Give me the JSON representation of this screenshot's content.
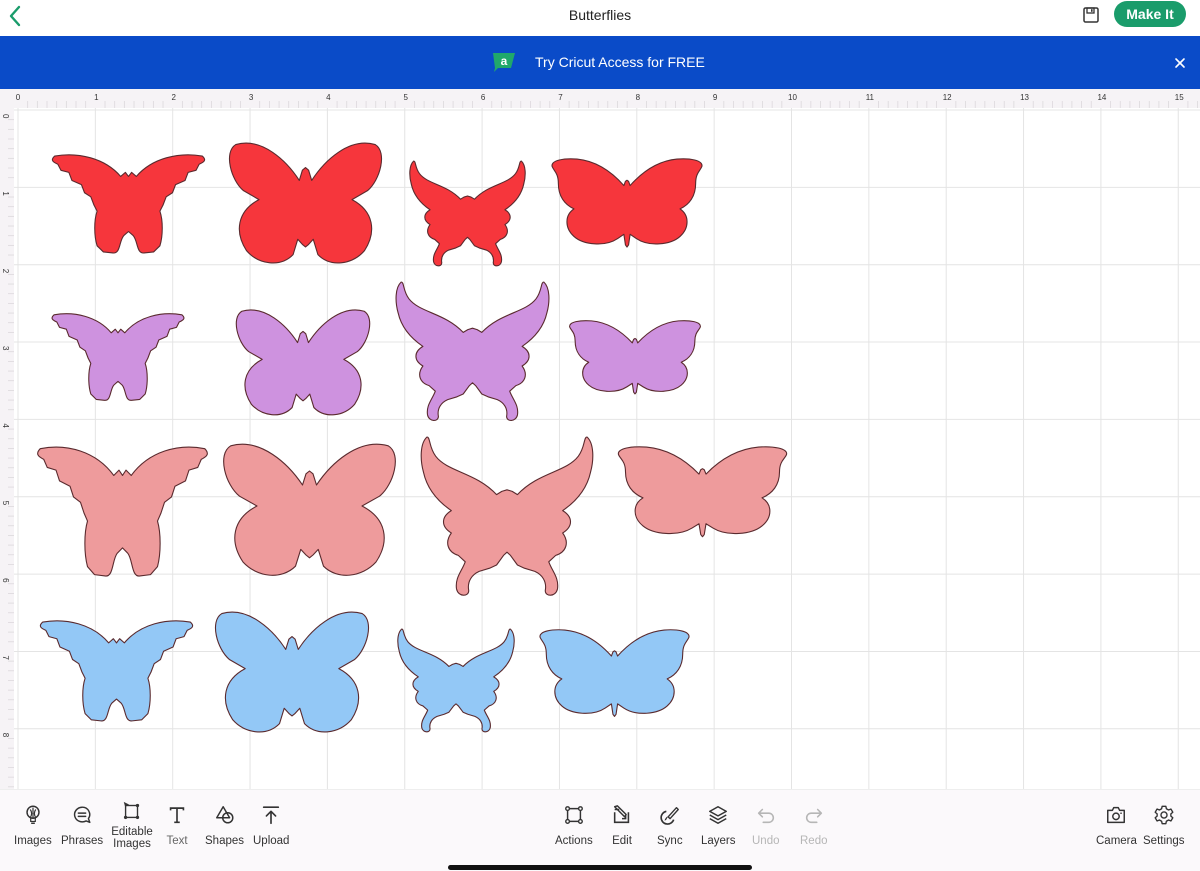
{
  "header": {
    "back_icon": "chevron-left-icon",
    "title": "Butterflies",
    "save_icon": "floppy-disk-icon",
    "make_it_label": "Make It"
  },
  "banner": {
    "icon": "cricut-access-logo",
    "text": "Try Cricut Access for FREE",
    "close_icon": "close-icon"
  },
  "colors": {
    "brand_green": "#1a9c6b",
    "banner_blue": "#0a4bc8",
    "red": "#f6363c",
    "purple": "#ce92df",
    "pink": "#ee9b9c",
    "blue": "#93c8f6"
  },
  "rulers": {
    "horizontal": [
      "0",
      "1",
      "2",
      "3",
      "4",
      "5",
      "6",
      "7",
      "8",
      "9",
      "10",
      "11",
      "12",
      "13",
      "14",
      "15"
    ],
    "vertical": [
      "0",
      "1",
      "2",
      "3",
      "4",
      "5",
      "6",
      "7",
      "8"
    ]
  },
  "canvas": {
    "rows": [
      {
        "color": "red",
        "shapes": [
          "scalloped",
          "rounded",
          "swallowtail",
          "classic"
        ]
      },
      {
        "color": "purple",
        "shapes": [
          "scalloped",
          "rounded",
          "swallowtail",
          "classic"
        ]
      },
      {
        "color": "pink",
        "shapes": [
          "scalloped",
          "rounded",
          "swallowtail",
          "classic"
        ]
      },
      {
        "color": "blue",
        "shapes": [
          "scalloped",
          "rounded",
          "swallowtail",
          "classic"
        ]
      }
    ]
  },
  "toolbar": {
    "left": [
      {
        "label": "Images",
        "icon": "lightbulb-icon"
      },
      {
        "label": "Phrases",
        "icon": "speech-bubble-icon"
      },
      {
        "label": "Editable Images",
        "icon": "editable-images-icon"
      },
      {
        "label": "Text",
        "icon": "text-t-icon"
      },
      {
        "label": "Shapes",
        "icon": "shapes-icon"
      },
      {
        "label": "Upload",
        "icon": "upload-icon"
      }
    ],
    "center": [
      {
        "label": "Actions",
        "icon": "actions-icon",
        "enabled": true
      },
      {
        "label": "Edit",
        "icon": "edit-icon",
        "enabled": true
      },
      {
        "label": "Sync",
        "icon": "sync-brush-icon",
        "enabled": true
      },
      {
        "label": "Layers",
        "icon": "layers-icon",
        "enabled": true
      },
      {
        "label": "Undo",
        "icon": "undo-icon",
        "enabled": false
      },
      {
        "label": "Redo",
        "icon": "redo-icon",
        "enabled": false
      }
    ],
    "right": [
      {
        "label": "Camera",
        "icon": "camera-icon"
      },
      {
        "label": "Settings",
        "icon": "gear-icon"
      }
    ]
  }
}
